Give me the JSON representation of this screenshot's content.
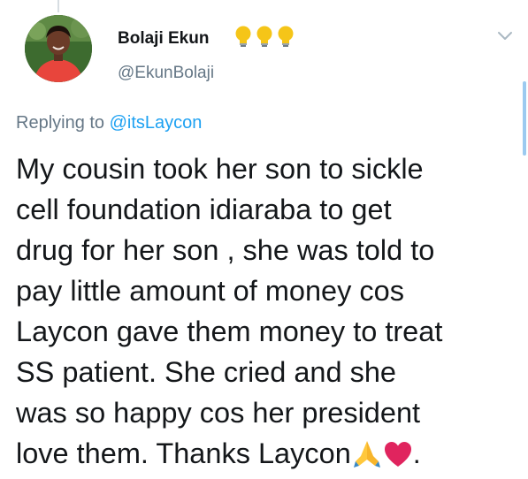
{
  "tweet": {
    "author": {
      "display_name": "Bolaji Ekun",
      "name_emoji": [
        "lightbulb-icon",
        "lightbulb-icon",
        "lightbulb-icon"
      ],
      "handle": "@EkunBolaji"
    },
    "replying_to": {
      "prefix": "Replying to",
      "mention": "@itsLaycon"
    },
    "text_lines": [
      "My cousin took her son to sickle",
      "cell foundation idiaraba to get",
      "drug for her son , she was told to",
      "pay little amount of money cos",
      "Laycon gave them money to treat",
      "SS patient. She cried and she",
      "was so happy cos her president",
      "love them. Thanks Laycon"
    ],
    "text_end": ".",
    "text_end_emoji": [
      "folded-hands-icon",
      "red-heart-icon"
    ],
    "menu_icon": "chevron-down-icon"
  },
  "colors": {
    "text": "#14171a",
    "secondary": "#657786",
    "link": "#1da1f2",
    "heart": "#e0245e",
    "bulb": "#f5c518"
  }
}
